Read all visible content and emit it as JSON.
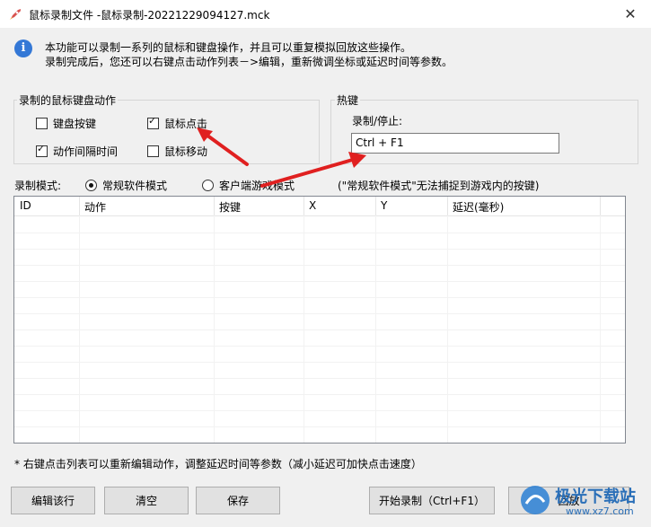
{
  "window": {
    "title": "鼠标录制文件 -鼠标录制-20221229094127.mck"
  },
  "info": {
    "line1": "本功能可以录制一系列的鼠标和键盘操作，并且可以重复模拟回放这些操作。",
    "line2": "录制完成后，您还可以右键点击动作列表－>编辑，重新微调坐标或延迟时间等参数。"
  },
  "actions_group": {
    "title": "录制的鼠标键盘动作",
    "keyboard": {
      "label": "键盘按键",
      "checked": false
    },
    "click": {
      "label": "鼠标点击",
      "checked": true
    },
    "interval": {
      "label": "动作间隔时间",
      "checked": true
    },
    "move": {
      "label": "鼠标移动",
      "checked": false
    }
  },
  "hotkey_group": {
    "title": "热键",
    "label": "录制/停止:",
    "value": "Ctrl + F1"
  },
  "mode": {
    "label": "录制模式:",
    "normal": "常规软件模式",
    "game": "客户端游戏模式",
    "selected": "normal",
    "note": "(\"常规软件模式\"无法捕捉到游戏内的按键)"
  },
  "table": {
    "columns": [
      "ID",
      "动作",
      "按键",
      "X",
      "Y",
      "延迟(毫秒)"
    ],
    "rows": []
  },
  "footer_note": "* 右键点击列表可以重新编辑动作，调整延迟时间等参数（减小延迟可加快点击速度）",
  "buttons": {
    "edit": "编辑该行",
    "clear": "清空",
    "save": "保存",
    "start": "开始录制（Ctrl+F1）",
    "replay": "回放"
  },
  "watermark": {
    "text": "极光下载站",
    "url_text": "www.xz7.com"
  },
  "colors": {
    "accent": "#3478d6",
    "arrow": "#e02020"
  }
}
